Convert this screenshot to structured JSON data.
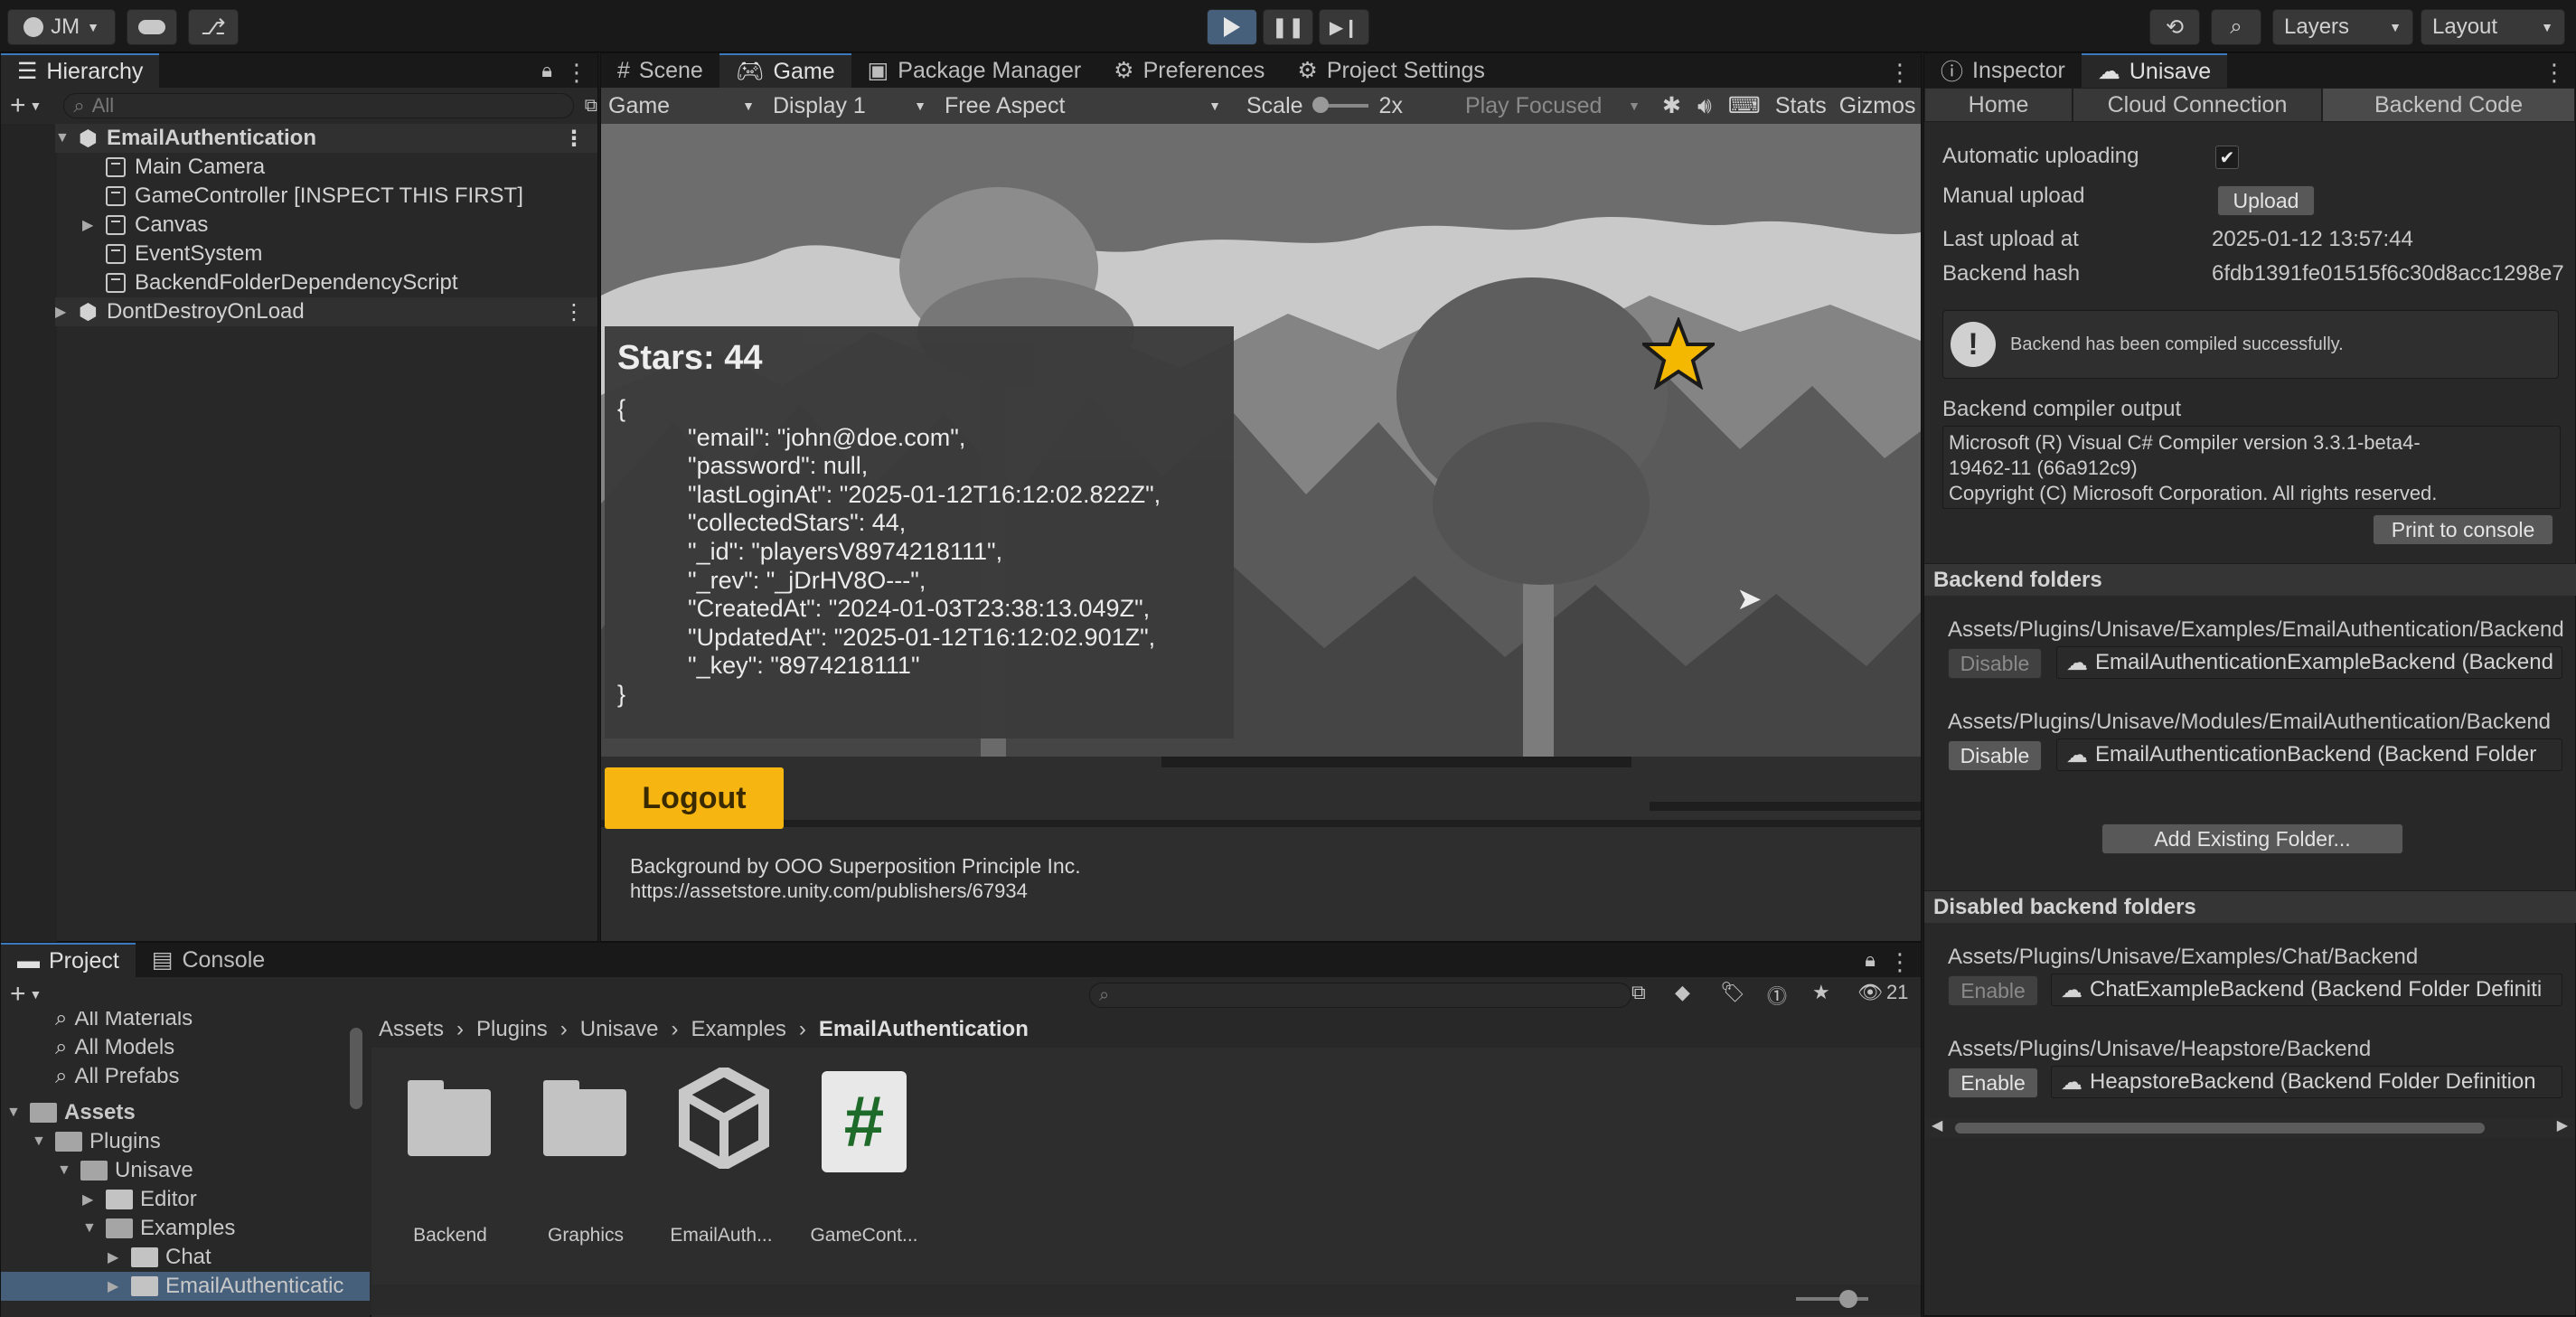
{
  "toolbar": {
    "account": "JM",
    "layers": "Layers",
    "layout": "Layout"
  },
  "hierarchy": {
    "tab": "Hierarchy",
    "search_placeholder": "All",
    "items": [
      {
        "label": "EmailAuthentication"
      },
      {
        "label": "Main Camera"
      },
      {
        "label": "GameController [INSPECT THIS FIRST]"
      },
      {
        "label": "Canvas"
      },
      {
        "label": "EventSystem"
      },
      {
        "label": "BackendFolderDependencyScript"
      },
      {
        "label": "DontDestroyOnLoad"
      }
    ]
  },
  "center_tabs": {
    "scene": "Scene",
    "game": "Game",
    "package_manager": "Package Manager",
    "preferences": "Preferences",
    "project_settings": "Project Settings"
  },
  "game_toolbar": {
    "mode": "Game",
    "display": "Display 1",
    "aspect": "Free Aspect",
    "scale_label": "Scale",
    "scale_value": "2x",
    "play_focused": "Play Focused",
    "stats": "Stats",
    "gizmos": "Gizmos"
  },
  "game": {
    "stars_title": "Stars: 44",
    "json_lines": [
      "{",
      "\"email\": \"john@doe.com\",",
      "\"password\": null,",
      "\"lastLoginAt\": \"2025-01-12T16:12:02.822Z\",",
      "\"collectedStars\": 44,",
      "\"_id\": \"playersV8974218111\",",
      "\"_rev\": \"_jDrHV8O---\",",
      "\"CreatedAt\": \"2024-01-03T23:38:13.049Z\",",
      "\"UpdatedAt\": \"2025-01-12T16:12:02.901Z\",",
      "\"_key\": \"8974218111\"",
      "}"
    ],
    "logout": "Logout",
    "credit_line1": "Background by OOO Superposition Principle Inc.",
    "credit_line2": "https://assetstore.unity.com/publishers/67934"
  },
  "right_tabs": {
    "inspector": "Inspector",
    "unisave": "Unisave"
  },
  "unisave": {
    "tabs": [
      "Home",
      "Cloud Connection",
      "Backend Code"
    ],
    "automatic_uploading": "Automatic uploading",
    "manual_upload": "Manual upload",
    "upload_button": "Upload",
    "last_upload_label": "Last upload at",
    "last_upload_value": "2025-01-12 13:57:44",
    "backend_hash_label": "Backend hash",
    "backend_hash_value": "6fdb1391fe01515f6c30d8acc1298e7",
    "compiled_message": "Backend has been compiled successfully.",
    "compiler_output_label": "Backend compiler output",
    "compiler_output_lines": [
      "Microsoft (R) Visual C# Compiler version 3.3.1-beta4-",
      "19462-11 (66a912c9)",
      "Copyright (C) Microsoft Corporation. All rights reserved."
    ],
    "print_to_console": "Print to console",
    "backend_folders_title": "Backend folders",
    "backend_folders": [
      {
        "path": "Assets/Plugins/Unisave/Examples/EmailAuthentication/Backend",
        "button": "Disable",
        "asset": "EmailAuthenticationExampleBackend (Backend"
      },
      {
        "path": "Assets/Plugins/Unisave/Modules/EmailAuthentication/Backend",
        "button": "Disable",
        "asset": "EmailAuthenticationBackend (Backend Folder"
      }
    ],
    "add_existing_folder": "Add Existing Folder...",
    "disabled_folders_title": "Disabled backend folders",
    "disabled_folders": [
      {
        "path": "Assets/Plugins/Unisave/Examples/Chat/Backend",
        "button": "Enable",
        "asset": "ChatExampleBackend (Backend Folder Definiti"
      },
      {
        "path": "Assets/Plugins/Unisave/Heapstore/Backend",
        "button": "Enable",
        "asset": "HeapstoreBackend (Backend Folder Definition"
      }
    ]
  },
  "project": {
    "tab_project": "Project",
    "tab_console": "Console",
    "hidden_count": "21",
    "breadcrumb": [
      "Assets",
      "Plugins",
      "Unisave",
      "Examples",
      "EmailAuthentication"
    ],
    "tree": [
      {
        "label": "All Materials"
      },
      {
        "label": "All Models"
      },
      {
        "label": "All Prefabs"
      },
      {
        "label": "Assets"
      },
      {
        "label": "Plugins"
      },
      {
        "label": "Unisave"
      },
      {
        "label": "Editor"
      },
      {
        "label": "Examples"
      },
      {
        "label": "Chat"
      },
      {
        "label": "EmailAuthenticatic"
      }
    ],
    "assets": [
      {
        "label": "Backend"
      },
      {
        "label": "Graphics"
      },
      {
        "label": "EmailAuth..."
      },
      {
        "label": "GameCont..."
      }
    ]
  }
}
